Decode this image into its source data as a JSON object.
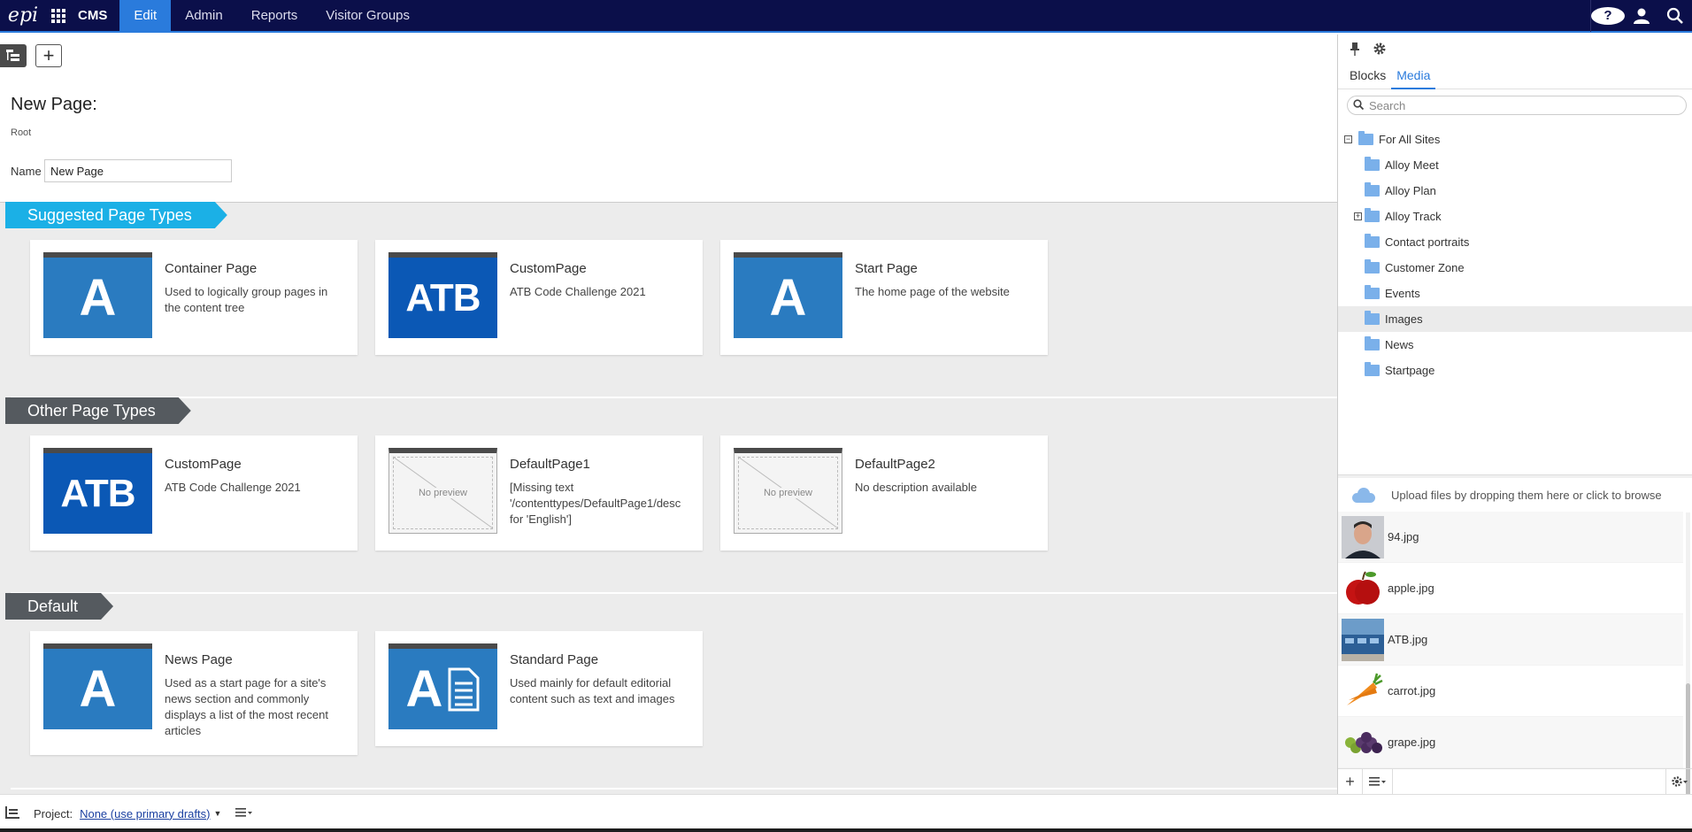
{
  "nav": {
    "logo": "epi",
    "product": "CMS",
    "tabs": [
      "Edit",
      "Admin",
      "Reports",
      "Visitor Groups"
    ],
    "active_tab": "Edit",
    "help": "?"
  },
  "header": {
    "title": "New Page:",
    "breadcrumb": "Root",
    "name_label": "Name",
    "name_value": "New Page"
  },
  "sections": [
    {
      "title": "Suggested Page Types",
      "cards": [
        {
          "title": "Container Page",
          "desc": "Used to logically group pages in the content tree",
          "thumb": "A"
        },
        {
          "title": "CustomPage",
          "desc": "ATB Code Challenge 2021",
          "thumb": "ATB"
        },
        {
          "title": "Start Page",
          "desc": "The home page of the website",
          "thumb": "A"
        }
      ]
    },
    {
      "title": "Other Page Types",
      "cards": [
        {
          "title": "CustomPage",
          "desc": "ATB Code Challenge 2021",
          "thumb": "ATB"
        },
        {
          "title": "DefaultPage1",
          "desc": "[Missing text '/contenttypes/DefaultPage1/desc for 'English']",
          "thumb": "No preview"
        },
        {
          "title": "DefaultPage2",
          "desc": "No description available",
          "thumb": "No preview"
        }
      ]
    },
    {
      "title": "Default",
      "cards": [
        {
          "title": "News Page",
          "desc": "Used as a start page for a site's news section and commonly displays a list of the most recent articles",
          "thumb": "A"
        },
        {
          "title": "Standard Page",
          "desc": "Used mainly for default editorial content such as text and images",
          "thumb": "A"
        }
      ]
    }
  ],
  "right_panel": {
    "tabs": [
      "Blocks",
      "Media"
    ],
    "active_tab": "Media",
    "search_placeholder": "Search",
    "tree_root": "For All Sites",
    "folders": [
      "Alloy Meet",
      "Alloy Plan",
      "Alloy Track",
      "Contact portraits",
      "Customer Zone",
      "Events",
      "Images",
      "News",
      "Startpage"
    ],
    "selected_folder": "Images",
    "upload_text": "Upload files by dropping them here or click to browse",
    "files": [
      "94.jpg",
      "apple.jpg",
      "ATB.jpg",
      "carrot.jpg",
      "grape.jpg"
    ]
  },
  "bottom": {
    "project_label": "Project:",
    "project_value": "None (use primary drafts)"
  },
  "colors": {
    "nav_bg": "#0b0f4a",
    "accent": "#2a7bdc",
    "suggested_ribbon": "#1bb0e6",
    "other_ribbon": "#555a5f",
    "tile_blue": "#2a7bc0",
    "atb_blue": "#0b58b5"
  }
}
